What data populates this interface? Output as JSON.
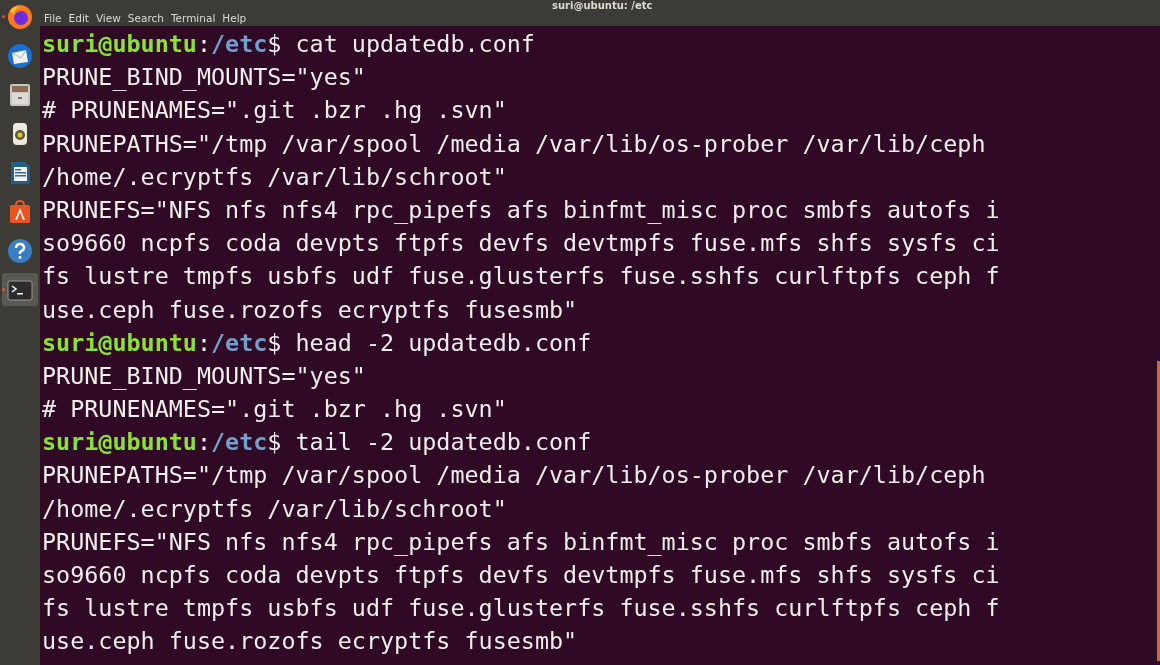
{
  "window": {
    "title": "suri@ubuntu: /etc"
  },
  "dock": [
    {
      "kind": "firefox",
      "running": true,
      "selected": false
    },
    {
      "kind": "mail",
      "running": false,
      "selected": false
    },
    {
      "kind": "files",
      "running": false,
      "selected": false
    },
    {
      "kind": "music",
      "running": false,
      "selected": false
    },
    {
      "kind": "writer",
      "running": false,
      "selected": false
    },
    {
      "kind": "software",
      "running": false,
      "selected": false
    },
    {
      "kind": "help",
      "running": false,
      "selected": false
    },
    {
      "kind": "terminal",
      "running": true,
      "selected": true
    }
  ],
  "menu": [
    "File",
    "Edit",
    "View",
    "Search",
    "Terminal",
    "Help"
  ],
  "lines": [
    {
      "kind": "prompt",
      "user": "suri@ubuntu",
      "separator": ":",
      "path": "/etc",
      "symbol": "$",
      "command": "cat updatedb.conf"
    },
    {
      "kind": "output",
      "text": "PRUNE_BIND_MOUNTS=\"yes\""
    },
    {
      "kind": "output",
      "text": "# PRUNENAMES=\".git .bzr .hg .svn\""
    },
    {
      "kind": "output",
      "text": "PRUNEPATHS=\"/tmp /var/spool /media /var/lib/os-prober /var/lib/ceph"
    },
    {
      "kind": "output",
      "text": "/home/.ecryptfs /var/lib/schroot\""
    },
    {
      "kind": "output",
      "text": "PRUNEFS=\"NFS nfs nfs4 rpc_pipefs afs binfmt_misc proc smbfs autofs i"
    },
    {
      "kind": "output",
      "text": "so9660 ncpfs coda devpts ftpfs devfs devtmpfs fuse.mfs shfs sysfs ci"
    },
    {
      "kind": "output",
      "text": "fs lustre tmpfs usbfs udf fuse.glusterfs fuse.sshfs curlftpfs ceph f"
    },
    {
      "kind": "output",
      "text": "use.ceph fuse.rozofs ecryptfs fusesmb\""
    },
    {
      "kind": "prompt",
      "user": "suri@ubuntu",
      "separator": ":",
      "path": "/etc",
      "symbol": "$",
      "command": "head -2 updatedb.conf"
    },
    {
      "kind": "output",
      "text": "PRUNE_BIND_MOUNTS=\"yes\""
    },
    {
      "kind": "output",
      "text": "# PRUNENAMES=\".git .bzr .hg .svn\""
    },
    {
      "kind": "prompt",
      "user": "suri@ubuntu",
      "separator": ":",
      "path": "/etc",
      "symbol": "$",
      "command": "tail -2 updatedb.conf"
    },
    {
      "kind": "output",
      "text": "PRUNEPATHS=\"/tmp /var/spool /media /var/lib/os-prober /var/lib/ceph"
    },
    {
      "kind": "output",
      "text": "/home/.ecryptfs /var/lib/schroot\""
    },
    {
      "kind": "output",
      "text": "PRUNEFS=\"NFS nfs nfs4 rpc_pipefs afs binfmt_misc proc smbfs autofs i"
    },
    {
      "kind": "output",
      "text": "so9660 ncpfs coda devpts ftpfs devfs devtmpfs fuse.mfs shfs sysfs ci"
    },
    {
      "kind": "output",
      "text": "fs lustre tmpfs usbfs udf fuse.glusterfs fuse.sshfs curlftpfs ceph f"
    },
    {
      "kind": "output",
      "text": "use.ceph fuse.rozofs ecryptfs fusesmb\""
    }
  ]
}
